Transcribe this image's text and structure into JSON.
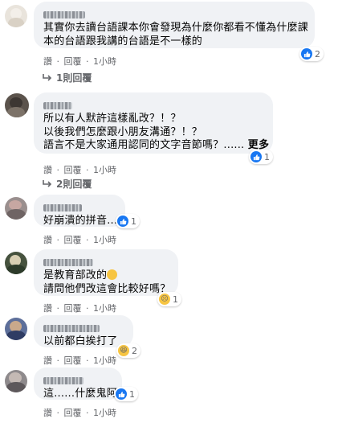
{
  "comments": [
    {
      "lines": [
        "其實你去讀台語課本你會發現為什麼你都看不懂為什麼課",
        "本的台語跟我講的台語是不一樣的"
      ],
      "actions": {
        "like": "讚",
        "reply": "回覆",
        "time": "1小時"
      },
      "reaction": {
        "icon": "like",
        "count": "2"
      },
      "replies_label": "1則回覆"
    },
    {
      "lines": [
        "所以有人默許這樣亂改？！？",
        "以後我們怎麼跟小朋友溝通？！？",
        "語言不是大家通用認同的文字音節嗎？......"
      ],
      "more_label": "更多",
      "actions": {
        "like": "讚",
        "reply": "回覆",
        "time": "1小時"
      },
      "reaction": {
        "icon": "like",
        "count": "1"
      },
      "replies_label": "2則回覆"
    },
    {
      "lines": [
        "好崩潰的拼音..."
      ],
      "actions": {
        "like": "讚",
        "reply": "回覆",
        "time": "1小時"
      },
      "reaction": {
        "icon": "like",
        "count": "1"
      }
    },
    {
      "lines": [
        "是教育部改的",
        "請問他們改這會比較好嗎？"
      ],
      "actions": {
        "like": "讚",
        "reply": "回覆",
        "time": "1小時"
      },
      "reaction": {
        "icon": "sad",
        "count": "1"
      }
    },
    {
      "lines": [
        "以前都白挨打了"
      ],
      "actions": {
        "like": "讚",
        "reply": "回覆",
        "time": "1小時"
      },
      "reaction": {
        "icon": "haha",
        "count": "2"
      }
    },
    {
      "lines": [
        "這......什麼鬼阿"
      ],
      "actions": {
        "like": "讚",
        "reply": "回覆",
        "time": "1小時"
      },
      "reaction": {
        "icon": "like",
        "count": "1"
      }
    }
  ],
  "separator": "·",
  "colors": {
    "like_blue": "#1877f2",
    "bubble_gray": "#f0f2f5",
    "meta_gray": "#65676b",
    "emoji_yellow": "#f7c542"
  }
}
